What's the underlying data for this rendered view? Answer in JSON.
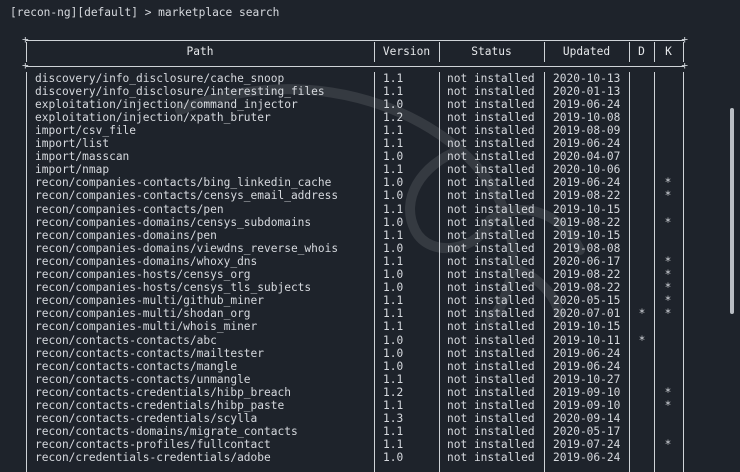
{
  "prompt": "[recon-ng][default] > marketplace search",
  "columns": {
    "path": "Path",
    "version": "Version",
    "status": "Status",
    "updated": "Updated",
    "d": "D",
    "k": "K"
  },
  "rows": [
    {
      "path": "discovery/info_disclosure/cache_snoop",
      "version": "1.1",
      "status": "not installed",
      "updated": "2020-10-13",
      "d": "",
      "k": ""
    },
    {
      "path": "discovery/info_disclosure/interesting_files",
      "version": "1.1",
      "status": "not installed",
      "updated": "2020-01-13",
      "d": "",
      "k": ""
    },
    {
      "path": "exploitation/injection/command_injector",
      "version": "1.0",
      "status": "not installed",
      "updated": "2019-06-24",
      "d": "",
      "k": ""
    },
    {
      "path": "exploitation/injection/xpath_bruter",
      "version": "1.2",
      "status": "not installed",
      "updated": "2019-10-08",
      "d": "",
      "k": ""
    },
    {
      "path": "import/csv_file",
      "version": "1.1",
      "status": "not installed",
      "updated": "2019-08-09",
      "d": "",
      "k": ""
    },
    {
      "path": "import/list",
      "version": "1.1",
      "status": "not installed",
      "updated": "2019-06-24",
      "d": "",
      "k": ""
    },
    {
      "path": "import/masscan",
      "version": "1.0",
      "status": "not installed",
      "updated": "2020-04-07",
      "d": "",
      "k": ""
    },
    {
      "path": "import/nmap",
      "version": "1.1",
      "status": "not installed",
      "updated": "2020-10-06",
      "d": "",
      "k": ""
    },
    {
      "path": "recon/companies-contacts/bing_linkedin_cache",
      "version": "1.0",
      "status": "not installed",
      "updated": "2019-06-24",
      "d": "",
      "k": "*"
    },
    {
      "path": "recon/companies-contacts/censys_email_address",
      "version": "1.0",
      "status": "not installed",
      "updated": "2019-08-22",
      "d": "",
      "k": "*"
    },
    {
      "path": "recon/companies-contacts/pen",
      "version": "1.1",
      "status": "not installed",
      "updated": "2019-10-15",
      "d": "",
      "k": ""
    },
    {
      "path": "recon/companies-domains/censys_subdomains",
      "version": "1.0",
      "status": "not installed",
      "updated": "2019-08-22",
      "d": "",
      "k": "*"
    },
    {
      "path": "recon/companies-domains/pen",
      "version": "1.1",
      "status": "not installed",
      "updated": "2019-10-15",
      "d": "",
      "k": ""
    },
    {
      "path": "recon/companies-domains/viewdns_reverse_whois",
      "version": "1.0",
      "status": "not installed",
      "updated": "2019-08-08",
      "d": "",
      "k": ""
    },
    {
      "path": "recon/companies-domains/whoxy_dns",
      "version": "1.1",
      "status": "not installed",
      "updated": "2020-06-17",
      "d": "",
      "k": "*"
    },
    {
      "path": "recon/companies-hosts/censys_org",
      "version": "1.0",
      "status": "not installed",
      "updated": "2019-08-22",
      "d": "",
      "k": "*"
    },
    {
      "path": "recon/companies-hosts/censys_tls_subjects",
      "version": "1.0",
      "status": "not installed",
      "updated": "2019-08-22",
      "d": "",
      "k": "*"
    },
    {
      "path": "recon/companies-multi/github_miner",
      "version": "1.1",
      "status": "not installed",
      "updated": "2020-05-15",
      "d": "",
      "k": "*"
    },
    {
      "path": "recon/companies-multi/shodan_org",
      "version": "1.1",
      "status": "not installed",
      "updated": "2020-07-01",
      "d": "*",
      "k": "*"
    },
    {
      "path": "recon/companies-multi/whois_miner",
      "version": "1.1",
      "status": "not installed",
      "updated": "2019-10-15",
      "d": "",
      "k": ""
    },
    {
      "path": "recon/contacts-contacts/abc",
      "version": "1.0",
      "status": "not installed",
      "updated": "2019-10-11",
      "d": "*",
      "k": ""
    },
    {
      "path": "recon/contacts-contacts/mailtester",
      "version": "1.0",
      "status": "not installed",
      "updated": "2019-06-24",
      "d": "",
      "k": ""
    },
    {
      "path": "recon/contacts-contacts/mangle",
      "version": "1.0",
      "status": "not installed",
      "updated": "2019-06-24",
      "d": "",
      "k": ""
    },
    {
      "path": "recon/contacts-contacts/unmangle",
      "version": "1.1",
      "status": "not installed",
      "updated": "2019-10-27",
      "d": "",
      "k": ""
    },
    {
      "path": "recon/contacts-credentials/hibp_breach",
      "version": "1.2",
      "status": "not installed",
      "updated": "2019-09-10",
      "d": "",
      "k": "*"
    },
    {
      "path": "recon/contacts-credentials/hibp_paste",
      "version": "1.1",
      "status": "not installed",
      "updated": "2019-09-10",
      "d": "",
      "k": "*"
    },
    {
      "path": "recon/contacts-credentials/scylla",
      "version": "1.3",
      "status": "not installed",
      "updated": "2020-09-14",
      "d": "",
      "k": ""
    },
    {
      "path": "recon/contacts-domains/migrate_contacts",
      "version": "1.1",
      "status": "not installed",
      "updated": "2020-05-17",
      "d": "",
      "k": ""
    },
    {
      "path": "recon/contacts-profiles/fullcontact",
      "version": "1.1",
      "status": "not installed",
      "updated": "2019-07-24",
      "d": "",
      "k": "*"
    },
    {
      "path": "recon/credentials-credentials/adobe",
      "version": "1.0",
      "status": "not installed",
      "updated": "2019-06-24",
      "d": "",
      "k": ""
    }
  ]
}
